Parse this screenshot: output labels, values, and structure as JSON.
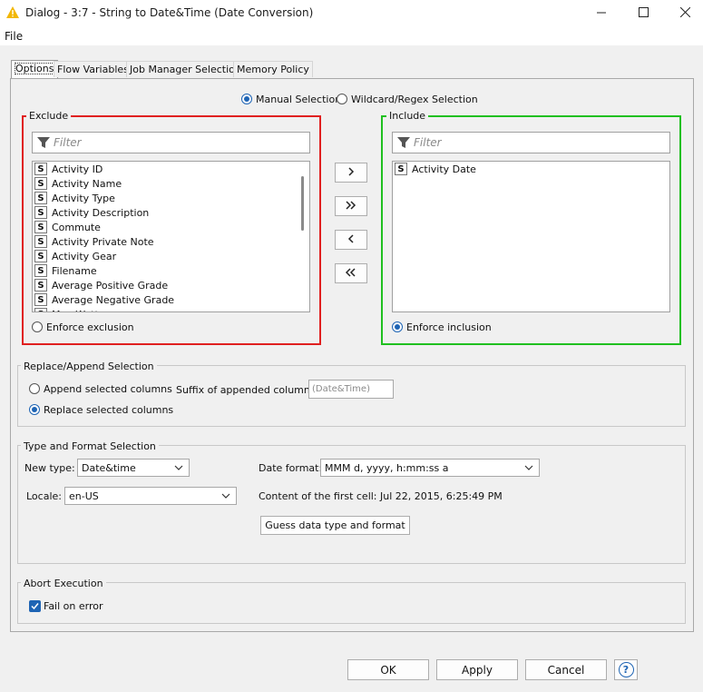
{
  "window": {
    "title": "Dialog - 3:7 - String to Date&Time (Date Conversion)"
  },
  "menu": {
    "file": "File"
  },
  "tabs": [
    {
      "label": "Options"
    },
    {
      "label": "Flow Variables"
    },
    {
      "label": "Job Manager Selection"
    },
    {
      "label": "Memory Policy"
    }
  ],
  "selection_mode": {
    "manual": "Manual Selection",
    "wildcard": "Wildcard/Regex Selection",
    "selected": "manual"
  },
  "exclude": {
    "title": "Exclude",
    "filter_placeholder": "Filter",
    "items": [
      "Activity ID",
      "Activity Name",
      "Activity Type",
      "Activity Description",
      "Commute",
      "Activity Private Note",
      "Activity Gear",
      "Filename",
      "Average Positive Grade",
      "Average Negative Grade",
      "Max Watts"
    ],
    "enforce_label": "Enforce exclusion",
    "type_badge": "S"
  },
  "include": {
    "title": "Include",
    "filter_placeholder": "Filter",
    "items": [
      "Activity Date"
    ],
    "enforce_label": "Enforce inclusion",
    "type_badge": "S"
  },
  "move_buttons": {
    "add": "›",
    "add_all": "»",
    "remove": "‹",
    "remove_all": "«"
  },
  "replace_append": {
    "title": "Replace/Append Selection",
    "append_label": "Append selected columns",
    "replace_label": "Replace selected columns",
    "suffix_label": "Suffix of appended columns:",
    "suffix_value": "(Date&Time)",
    "selected": "replace"
  },
  "type_format": {
    "title": "Type and Format Selection",
    "new_type_label": "New type:",
    "new_type_value": "Date&time",
    "date_format_label": "Date format:",
    "date_format_value": "MMM d, yyyy, h:mm:ss a",
    "locale_label": "Locale:",
    "locale_value": "en-US",
    "first_cell_label": "Content of the first cell:",
    "first_cell_value": "Jul 22, 2015, 6:25:49 PM",
    "guess_button": "Guess data type and format"
  },
  "abort": {
    "title": "Abort Execution",
    "fail_label": "Fail on error",
    "fail_checked": true
  },
  "footer": {
    "ok": "OK",
    "apply": "Apply",
    "cancel": "Cancel",
    "help": "?"
  },
  "colors": {
    "exclude_border": "#e02020",
    "include_border": "#20c020",
    "accent": "#1e64b4",
    "title_icon": "#f2b705"
  }
}
